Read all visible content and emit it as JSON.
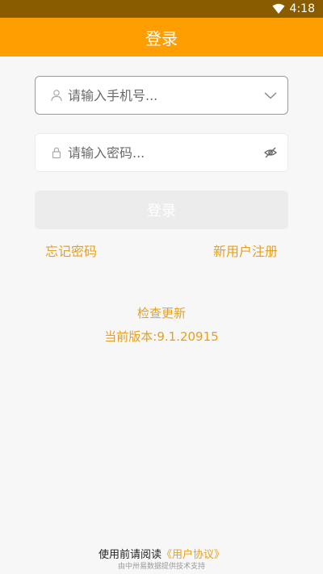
{
  "status_bar": {
    "time": "4:18"
  },
  "header": {
    "title": "登录"
  },
  "form": {
    "phone_placeholder": "请输入手机号...",
    "password_placeholder": "请输入密码...",
    "login_label": "登录"
  },
  "links": {
    "forgot_password": "忘记密码",
    "new_user_register": "新用户注册"
  },
  "update": {
    "check_update": "检查更新",
    "version": "当前版本:9.1.20915"
  },
  "footer": {
    "prefix": "使用前请阅读",
    "agreement": "《用户协议》",
    "powered_by": "由中卅易数据提供技术支持"
  },
  "colors": {
    "accent": "#ff9e01",
    "status_bar": "#8a5c00",
    "link": "#e6a01e"
  },
  "icons": [
    "wifi-icon",
    "user-icon",
    "chevron-down-icon",
    "lock-icon",
    "eye-off-icon"
  ]
}
